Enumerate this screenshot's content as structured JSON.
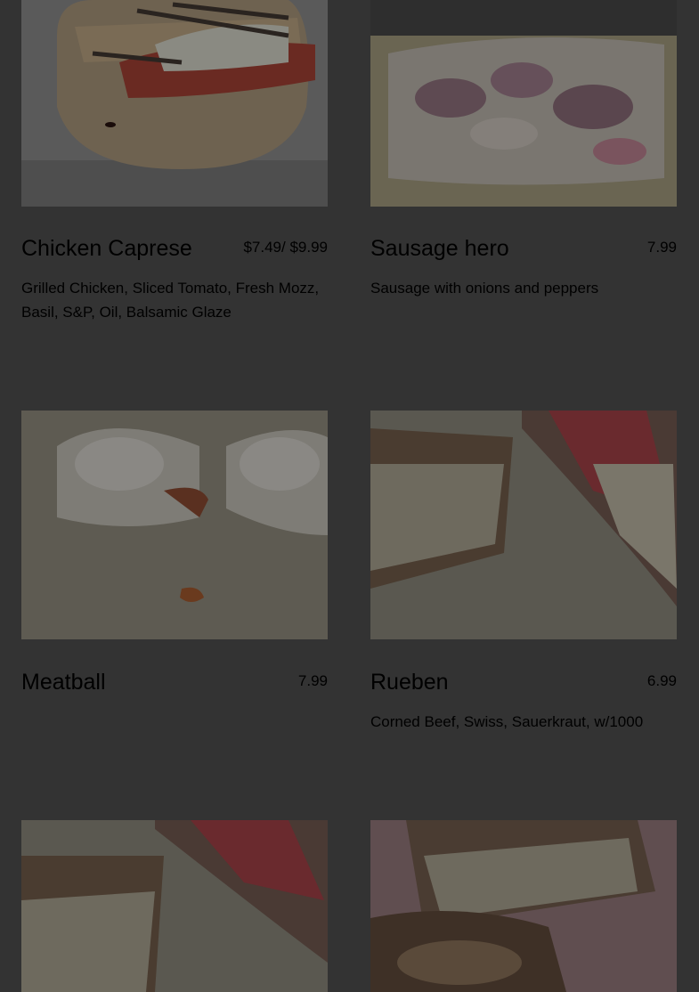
{
  "menu": {
    "items": [
      {
        "name": "Chicken Caprese",
        "price": "$7.49/ $9.99",
        "description": "Grilled Chicken, Sliced Tomato, Fresh Mozz, Basil, S&P, Oil, Balsamic Glaze",
        "photo": "chicken-caprese-photo"
      },
      {
        "name": "Sausage hero",
        "price": "7.99",
        "description": "Sausage with onions and peppers",
        "photo": "sausage-hero-photo"
      },
      {
        "name": "Meatball",
        "price": "7.99",
        "description": "",
        "photo": "meatball-photo"
      },
      {
        "name": "Rueben",
        "price": "6.99",
        "description": "Corned Beef, Swiss, Sauerkraut, w/1000",
        "photo": "rueben-photo"
      },
      {
        "photo": "rueben-photo-2"
      },
      {
        "photo": "rueben-photo-3"
      }
    ]
  },
  "colors": {
    "page_background": "#333333",
    "text": "#000000",
    "overlay": "rgba(0,0,0,0.6)"
  }
}
